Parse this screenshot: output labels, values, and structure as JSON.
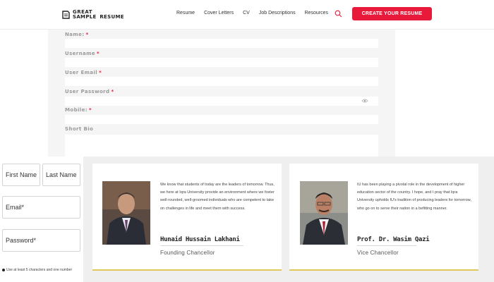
{
  "header": {
    "logo": {
      "line1": "GREAT",
      "line2a": "SAMPLE",
      "line2b": "RESUME"
    },
    "nav": [
      "Resume",
      "Cover Letters",
      "CV",
      "Job Descriptions",
      "Resources"
    ],
    "cta_label": "CREATE YOUR RESUME",
    "accent": "#e8193b"
  },
  "form": {
    "fields": [
      {
        "label": "Name:",
        "required": "*"
      },
      {
        "label": "Username",
        "required": "*"
      },
      {
        "label": "User Email",
        "required": "*"
      },
      {
        "label": "User Password",
        "required": "*"
      },
      {
        "label": "Mobile:",
        "required": "*"
      },
      {
        "label": "Short Bio",
        "required": ""
      }
    ]
  },
  "mini_form": {
    "first_name": "First Name",
    "last_name": "Last Name",
    "email": "Email*",
    "password": "Password*",
    "note": "Use at least 5 characters and one number"
  },
  "cards": [
    {
      "text": "We know that students of today are the leaders of tomorrow. Thus, we here at Iqra University provide an environment where we foster well-rounded, well-groomed individuals who are competent to take on challenges in life and meet them with success.",
      "name": "Hunaid Hussain Lakhani",
      "role": "Founding Chancellor"
    },
    {
      "text": "IU has been playing a pivotal role in the development of higher education sector of the country. I hope, and I pray that Iqra University upholds IU's tradition of producing leaders for tomorrow, who go on to serve their nation in a befitting manner.",
      "name": "Prof. Dr. Wasim Qazi",
      "role": "Vice Chancellor"
    }
  ],
  "colors": {
    "card_accent": "#e2c85a",
    "panel_bg": "#f5f5f5"
  }
}
